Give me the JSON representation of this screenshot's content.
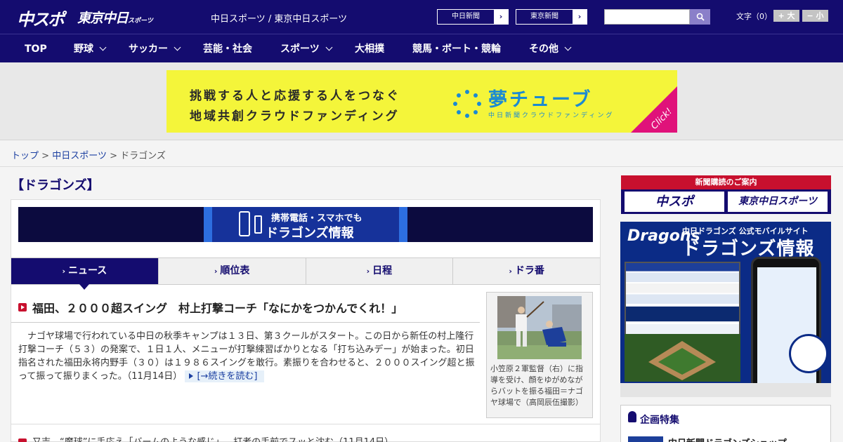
{
  "header": {
    "logo_chuspo": "中スポ",
    "logo_tokyo": "東京中日",
    "logo_tokyo_suffix": "スポーツ",
    "site_title": "中日スポーツ / 東京中日スポーツ",
    "ext_links": [
      {
        "label": "中日新聞",
        "arrow": "›"
      },
      {
        "label": "東京新聞",
        "arrow": "›"
      }
    ],
    "search": {
      "value": "",
      "placeholder": ""
    },
    "font_size_label": "文字（0）",
    "font_bigger": "+ 大",
    "font_smaller": "− 小"
  },
  "nav": {
    "items": [
      {
        "label": "TOP",
        "has_menu": false
      },
      {
        "label": "野球",
        "has_menu": true
      },
      {
        "label": "サッカー",
        "has_menu": true
      },
      {
        "label": "芸能・社会",
        "has_menu": false
      },
      {
        "label": "スポーツ",
        "has_menu": true
      },
      {
        "label": "大相撲",
        "has_menu": false
      },
      {
        "label": "競馬・ボート・競輪",
        "has_menu": false
      },
      {
        "label": "その他",
        "has_menu": true
      }
    ]
  },
  "ad_banner": {
    "line1": "挑戦する人と応援する人をつなぐ",
    "line2": "地域共創クラウドファンディング",
    "brand": "夢チューブ",
    "brand_sub": "中日新聞クラウドファンディング",
    "click": "Click!",
    "bg_color": "#f4f53a",
    "accent_color": "#1b8ad2"
  },
  "breadcrumb": {
    "items": [
      "トップ",
      "中日スポーツ"
    ],
    "separator": ">",
    "current": "ドラゴンズ"
  },
  "main": {
    "section_title": "【ドラゴンズ】",
    "mobile_banner": {
      "line1": "携帯電話・スマホでも",
      "line2": "ドラゴンズ情報"
    },
    "tabs": [
      {
        "label": "ニュース",
        "active": true
      },
      {
        "label": "順位表",
        "active": false
      },
      {
        "label": "日程",
        "active": false
      },
      {
        "label": "ドラ番",
        "active": false
      }
    ],
    "tab_caret": "›",
    "top_story": {
      "headline": "福田、２０００超スイング　村上打撃コーチ「なにかをつかんでくれ！」",
      "body": "　ナゴヤ球場で行われている中日の秋季キャンプは１３日、第３クールがスタート。この日から新任の村上隆行打撃コーチ（５３）の発案で、１日１人、メニューが打撃練習ばかりとなる「打ち込みデー」が始まった。初日指名された福田永将内野手（３０）は１９８６スイングを敢行。素振りを合わせると、２０００スイング超と振って振って振りまくった。",
      "date": "（11月14日）",
      "read_more": "[→続きを読む]",
      "photo_caption": "小笠原２軍監督（右）に指導を受け、顔をゆがめながらバットを振る福田＝ナゴヤ球場で（高岡辰伍撮影）"
    },
    "second_story": {
      "headline": "又吉、“魔球”に手応え「バームのような感じ」…打者の手前でスッと沈む（11月14日）"
    }
  },
  "sidebar": {
    "subscribe_head": "新聞購読のご案内",
    "subscribe_logos": [
      "中スポ",
      "東京中日スポーツ"
    ],
    "dragons_ad": {
      "logo": "Dragons",
      "title_small": "中日ドラゴンズ 公式モバイルサイト",
      "title_large": "ドラゴンズ情報"
    },
    "kikaku_title": "企画特集",
    "kikaku_item": "中日新聞ドラゴンズショップ"
  },
  "colors": {
    "brand_navy": "#140c6f",
    "accent_red": "#c8102e",
    "link_blue": "#1a3ea0"
  }
}
